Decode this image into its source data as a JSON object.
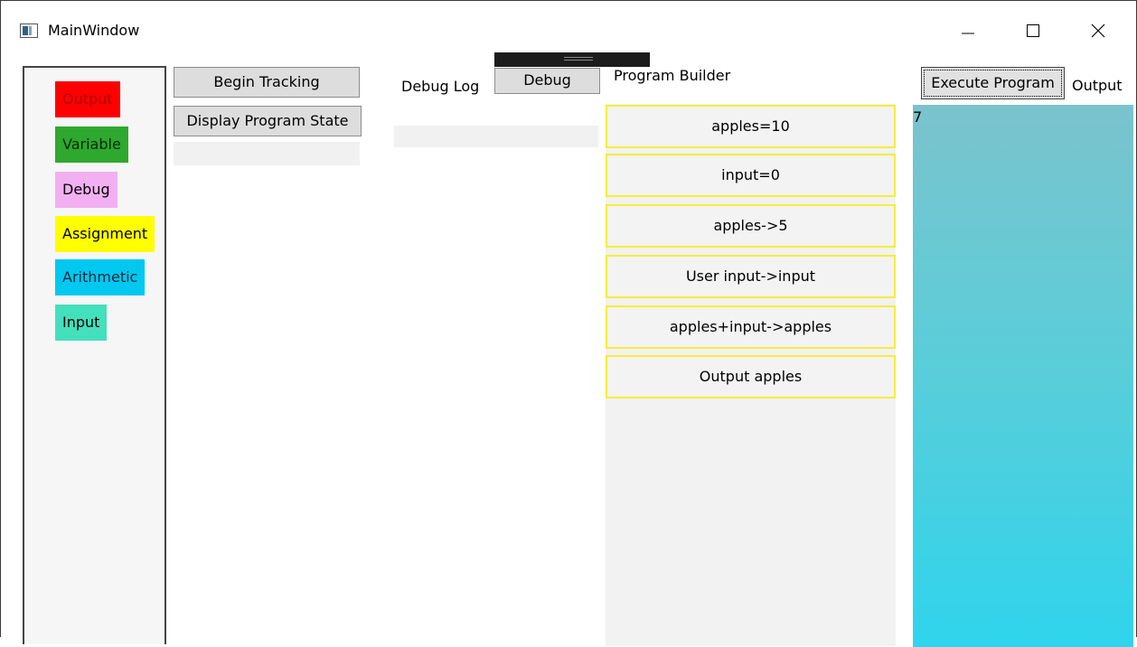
{
  "window": {
    "title": "MainWindow"
  },
  "palette": {
    "items": [
      {
        "label": "Output",
        "bg": "#ff0000",
        "fg": "#b00000"
      },
      {
        "label": "Variable",
        "bg": "#2ea82e",
        "fg": "#0a2a0a"
      },
      {
        "label": "Debug",
        "bg": "#f2b0f2",
        "fg": "#000000"
      },
      {
        "label": "Assignment",
        "bg": "#ffff00",
        "fg": "#000000"
      },
      {
        "label": "Arithmetic",
        "bg": "#00c8f0",
        "fg": "#0a2a3a"
      },
      {
        "label": "Input",
        "bg": "#44e0bc",
        "fg": "#000000"
      }
    ]
  },
  "tracking": {
    "begin_label": "Begin Tracking",
    "display_label": "Display Program State",
    "state_value": ""
  },
  "debug": {
    "log_label": "Debug Log",
    "button_label": "Debug",
    "log_value": ""
  },
  "builder": {
    "label": "Program Builder",
    "blocks": [
      "apples=10",
      "input=0",
      "apples->5",
      "User input->input",
      "apples+input->apples",
      "Output apples"
    ]
  },
  "output": {
    "execute_label": "Execute Program",
    "label": "Output",
    "value": "7"
  }
}
